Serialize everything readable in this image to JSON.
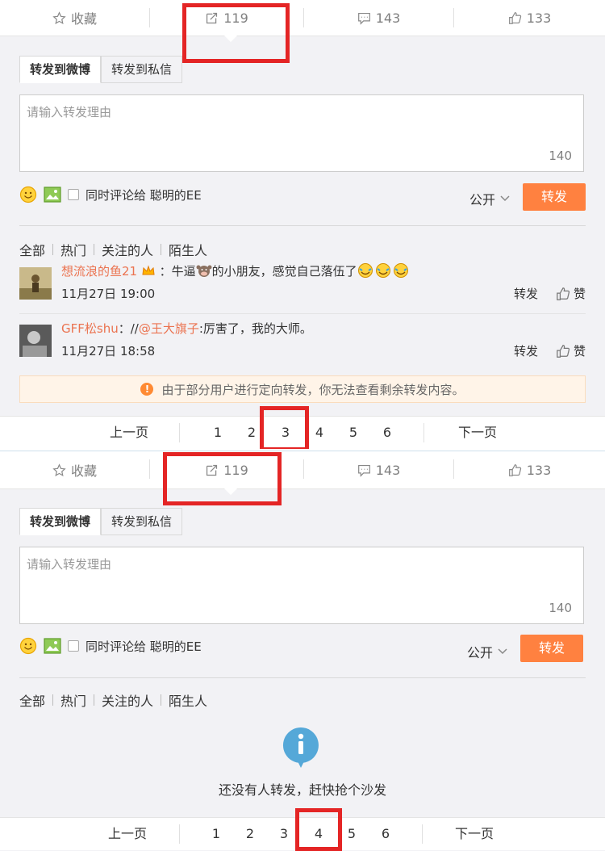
{
  "panels": [
    {
      "actions": {
        "favorite": "收藏",
        "repost_count": "119",
        "comment_count": "143",
        "like_count": "133"
      },
      "tabs": {
        "weibo": "转发到微博",
        "private": "转发到私信"
      },
      "input": {
        "placeholder": "请输入转发理由",
        "counter": "140"
      },
      "tools": {
        "also_comment": "同时评论给 聪明的EE",
        "scope": "公开",
        "submit": "转发"
      },
      "filters": [
        "全部",
        "热门",
        "关注的人",
        "陌生人"
      ],
      "comments": [
        {
          "user": "想流浪的鱼21",
          "text_a": "：牛逼",
          "text_b": "的小朋友，感觉自己落伍了",
          "time": "11月27日 19:00",
          "repost": "转发",
          "like": "赞"
        },
        {
          "user": "GFF松shu",
          "text_a": "：//",
          "mention": "@王大旗子",
          "text_b": ":厉害了，我的大师。",
          "time": "11月27日 18:58",
          "repost": "转发",
          "like": "赞"
        }
      ],
      "notice": "由于部分用户进行定向转发，你无法查看剩余转发内容。",
      "pager": {
        "prev": "上一页",
        "pages": [
          "1",
          "2",
          "3",
          "4",
          "5",
          "6"
        ],
        "current": "3",
        "next": "下一页"
      }
    },
    {
      "actions": {
        "favorite": "收藏",
        "repost_count": "119",
        "comment_count": "143",
        "like_count": "133"
      },
      "tabs": {
        "weibo": "转发到微博",
        "private": "转发到私信"
      },
      "input": {
        "placeholder": "请输入转发理由",
        "counter": "140"
      },
      "tools": {
        "also_comment": "同时评论给 聪明的EE",
        "scope": "公开",
        "submit": "转发"
      },
      "filters": [
        "全部",
        "热门",
        "关注的人",
        "陌生人"
      ],
      "empty": "还没有人转发，赶快抢个沙发",
      "pager": {
        "prev": "上一页",
        "pages": [
          "1",
          "2",
          "3",
          "4",
          "5",
          "6"
        ],
        "current": "4",
        "next": "下一页"
      }
    }
  ],
  "colors": {
    "accent": "#ff8140",
    "username": "#eb7350",
    "highlight_box": "#e42525",
    "info": "#55a8d8"
  }
}
